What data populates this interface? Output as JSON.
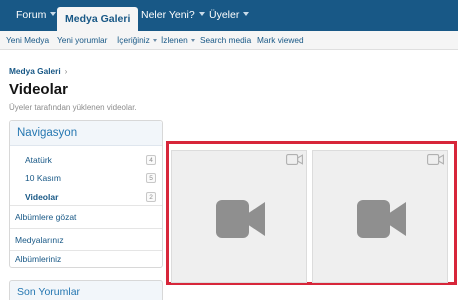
{
  "topnav": {
    "items": [
      {
        "label": "Forum",
        "has_menu": true
      },
      {
        "label": "Medya Galeri",
        "active": true
      },
      {
        "label": "Neler Yeni?",
        "has_menu": true
      },
      {
        "label": "Üyeler",
        "has_menu": true
      }
    ]
  },
  "subnav": {
    "items": [
      {
        "label": "Yeni Medya"
      },
      {
        "label": "Yeni yorumlar"
      },
      {
        "label": "İçeriğiniz",
        "has_menu": true
      },
      {
        "label": "İzlenen",
        "has_menu": true
      },
      {
        "label": "Search media"
      },
      {
        "label": "Mark viewed"
      }
    ]
  },
  "breadcrumb": {
    "items": [
      {
        "label": "Medya Galeri"
      }
    ]
  },
  "page": {
    "title": "Videolar",
    "description": "Üyeler tarafından yüklenen videolar."
  },
  "sidebar": {
    "title": "Navigasyon",
    "categories": [
      {
        "label": "Atatürk",
        "count": "4"
      },
      {
        "label": "10 Kasım",
        "count": "5"
      },
      {
        "label": "Videolar",
        "count": "2",
        "current": true
      }
    ],
    "links": [
      {
        "label": "Albümlere gözat"
      },
      {
        "label": "Medyalarınız"
      },
      {
        "label": "Albümleriniz"
      }
    ],
    "section2_title": "Son Yorumlar"
  },
  "media": {
    "items": [
      {
        "type": "video",
        "icon": "video-camera-icon"
      },
      {
        "type": "video",
        "icon": "video-camera-icon"
      }
    ]
  },
  "colors": {
    "nav_bg": "#185886",
    "link": "#185886",
    "accent": "#2577b1",
    "highlight_border": "#d7263a",
    "tile_bg": "#efefef",
    "icon_gray": "#8f8f8f"
  }
}
